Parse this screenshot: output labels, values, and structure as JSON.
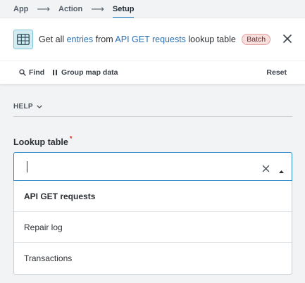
{
  "breadcrumb": {
    "items": [
      "App",
      "Action",
      "Setup"
    ]
  },
  "header": {
    "prefix": "Get all ",
    "entries_link": "entries",
    "middle": " from ",
    "table_link": "API GET requests",
    "suffix": " lookup table",
    "badge": "Batch"
  },
  "toolbar": {
    "find_label": "Find",
    "group_label": "Group map data",
    "reset_label": "Reset"
  },
  "help": {
    "label": "HELP"
  },
  "field": {
    "label": "Lookup table",
    "required_mark": "*",
    "value": ""
  },
  "dropdown": {
    "options": [
      "API GET requests",
      "Repair log",
      "Transactions"
    ],
    "selected_index": 0
  },
  "colors": {
    "accent": "#2a85c6",
    "link": "#2a6fb0",
    "badge_bg": "#f9dede",
    "required": "#d03a2e"
  }
}
